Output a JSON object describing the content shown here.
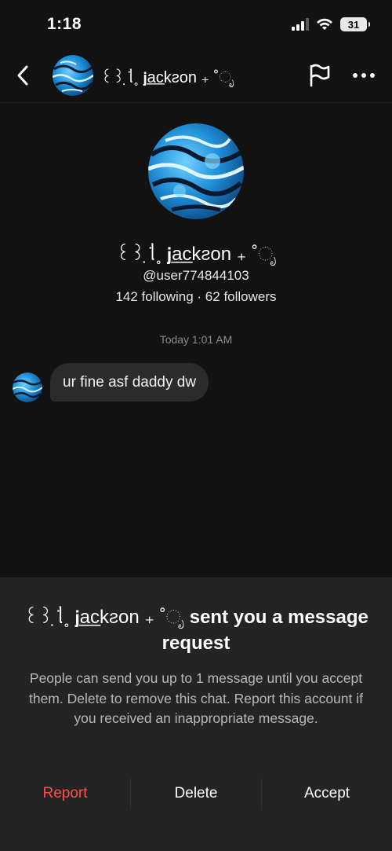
{
  "status_bar": {
    "time": "1:18",
    "battery": "31"
  },
  "nav": {
    "name": "꒰꒱ ̣̇ᥣ˳ 𝗷a̲c̲kƨon ₊ ‌˚ೃ",
    "back_icon": "chevron-left-icon",
    "flag_icon": "flag-icon",
    "more_icon": "more-horizontal-icon"
  },
  "profile": {
    "name": "꒰꒱ ̣̇ᥣ˳ 𝗷a̲c̲kƨon ₊ ‌˚ೃ",
    "handle": "@user774844103",
    "stats": "142 following · 62 followers"
  },
  "thread": {
    "timestamp": "Today 1:01 AM",
    "messages": [
      {
        "text": "ur fine asf daddy dw"
      }
    ]
  },
  "request": {
    "name": "꒰꒱ ̣̇ᥣ˳ 𝗷a̲c̲kƨon ₊ ‌˚ೃ",
    "title_suffix": " sent you a message request",
    "description": "People can send you up to 1 message until you accept them. Delete to remove this chat. Report this account if you received an inappropriate message.",
    "report_label": "Report",
    "delete_label": "Delete",
    "accept_label": "Accept"
  },
  "colors": {
    "background": "#121212",
    "panel": "#242424",
    "report": "#ff4d4d",
    "bubble": "#2b2b2b"
  }
}
